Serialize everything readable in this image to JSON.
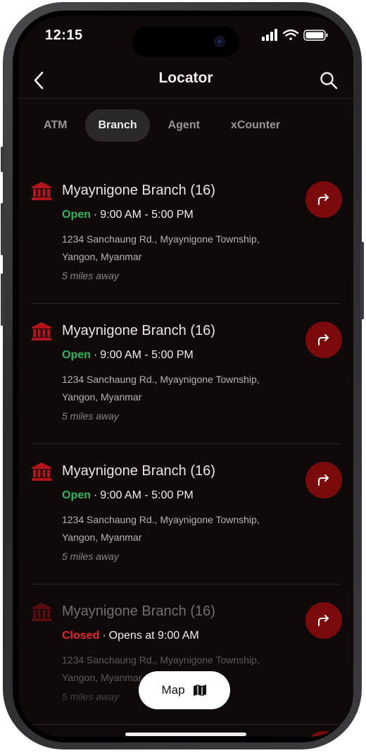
{
  "status_bar": {
    "time": "12:15"
  },
  "header": {
    "title": "Locator",
    "back_icon": "chevron-left-icon",
    "search_icon": "search-icon"
  },
  "tabs": [
    {
      "label": "ATM",
      "active": false
    },
    {
      "label": "Branch",
      "active": true
    },
    {
      "label": "Agent",
      "active": false
    },
    {
      "label": "xCounter",
      "active": false
    }
  ],
  "locations": [
    {
      "name": "Myaynigone Branch (16)",
      "status": "Open",
      "hours": "9:00 AM - 5:00 PM",
      "address_line1": "1234 Sanchaung Rd., Myaynigone Township,",
      "address_line2": "Yangon, Myanmar",
      "distance": "5 miles away"
    },
    {
      "name": "Myaynigone Branch (16)",
      "status": "Open",
      "hours": "9:00 AM - 5:00 PM",
      "address_line1": "1234 Sanchaung Rd., Myaynigone Township,",
      "address_line2": "Yangon, Myanmar",
      "distance": "5 miles away"
    },
    {
      "name": "Myaynigone Branch (16)",
      "status": "Open",
      "hours": "9:00 AM - 5:00 PM",
      "address_line1": "1234 Sanchaung Rd., Myaynigone Township,",
      "address_line2": "Yangon, Myanmar",
      "distance": "5 miles away"
    },
    {
      "name": "Myaynigone Branch (16)",
      "status": "Closed",
      "hours": "Opens at 9:00 AM",
      "address_line1": "1234 Sanchaung Rd., Myaynigone Township,",
      "address_line2": "Yangon, Myanmar",
      "distance": "5 miles away"
    }
  ],
  "map_button": {
    "label": "Map",
    "icon": "map-icon"
  },
  "colors": {
    "accent": "#7a0a0c",
    "open": "#2fb85a",
    "closed": "#e2262c",
    "background": "#0f0909"
  }
}
